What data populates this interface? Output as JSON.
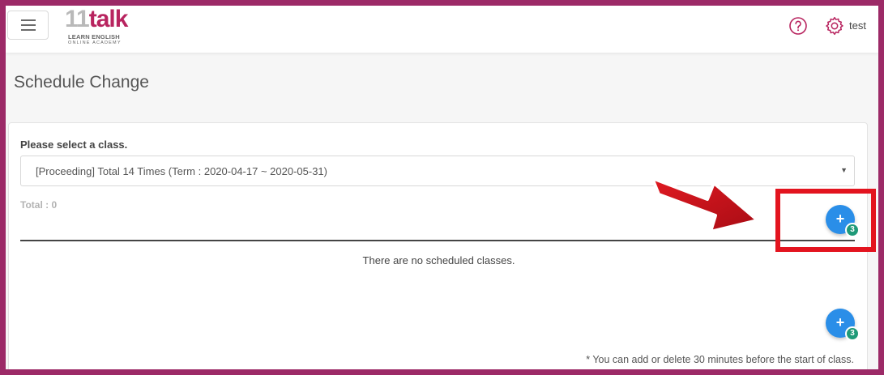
{
  "header": {
    "menu_label": "menu",
    "logo": {
      "main_num": "11",
      "main_text": "talk",
      "line1": "LEARN ENGLISH",
      "line2": "ONLINE ACADEMY"
    },
    "help_icon": "help-circle",
    "settings_icon": "gear",
    "user_name": "test"
  },
  "page": {
    "title": "Schedule Change"
  },
  "class_panel": {
    "select_label": "Please select a class.",
    "selected_class": "[Proceeding] Total 14 Times (Term : 2020-04-17 ~ 2020-05-31)",
    "total": "Total : 0",
    "empty_message": "There are no scheduled classes.",
    "add_button_symbol": "+",
    "add_button_badge": "3",
    "note": "* You can add or delete 30 minutes before the start of class."
  },
  "annotation": {
    "highlight_color": "#e3141f",
    "arrow_color": "#c4101a"
  },
  "colors": {
    "brand": "#b8245f",
    "frame": "#9c2a67",
    "fab": "#2a8ee8",
    "badge": "#1f9a78"
  }
}
